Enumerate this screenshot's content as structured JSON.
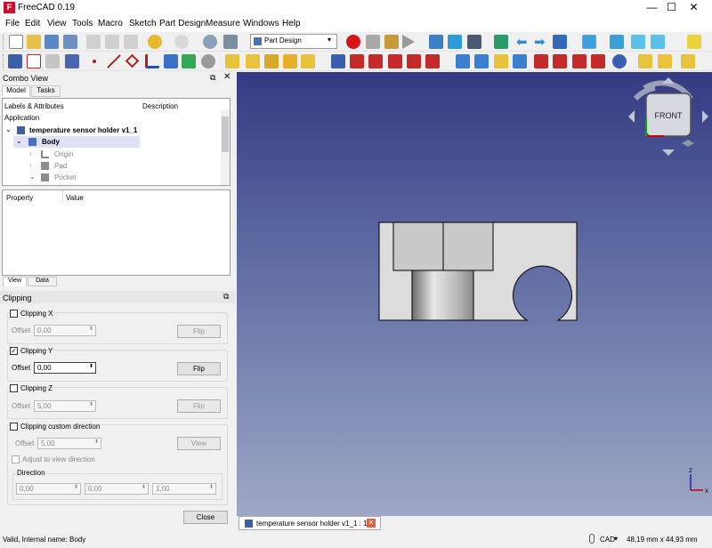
{
  "window": {
    "title": "FreeCAD 0.19",
    "icon": "freecad-icon",
    "icon_letter": "F",
    "minimize": "—",
    "maximize": "☐",
    "close": "✕"
  },
  "menu": [
    "File",
    "Edit",
    "View",
    "Tools",
    "Macro",
    "Sketch",
    "Part Design",
    "Measure",
    "Windows",
    "Help"
  ],
  "toolbar": {
    "workbench": "Part Design"
  },
  "combo": {
    "title": "Combo View",
    "tabs": [
      "Model",
      "Tasks"
    ],
    "tree_header": {
      "labels": "Labels & Attributes",
      "description": "Description"
    },
    "tree": {
      "section": "Application",
      "document": "temperature sensor holder v1_1",
      "body": "Body",
      "children": [
        "Origin",
        "Pad",
        "Pocket"
      ]
    },
    "property_header": {
      "property": "Property",
      "value": "Value"
    },
    "view_tabs": [
      "View",
      "Data"
    ]
  },
  "clipping": {
    "title": "Clipping",
    "x": {
      "label": "Clipping X",
      "checked": false,
      "offset_label": "Offset",
      "offset": "0,00",
      "flip": "Flip"
    },
    "y": {
      "label": "Clipping Y",
      "checked": true,
      "offset_label": "Offset",
      "offset": "0,00",
      "flip": "Flip"
    },
    "z": {
      "label": "Clipping Z",
      "checked": false,
      "offset_label": "Offset",
      "offset": "5,00",
      "flip": "Flip"
    },
    "custom": {
      "label": "Clipping custom direction",
      "checked": false,
      "offset_label": "Offset",
      "offset": "5,00",
      "view": "View",
      "adjust": "Adjust to view direction",
      "direction_label": "Direction",
      "direction": [
        "0,00",
        "0,00",
        "1,00"
      ]
    },
    "close": "Close"
  },
  "navcube": {
    "face": "FRONT"
  },
  "axes": {
    "x": "x",
    "z": "z"
  },
  "document_tab": "temperature sensor holder v1_1 : 1*",
  "status": {
    "left": "Valid, Internal name: Body",
    "nav_style": "CAD",
    "dimensions": "48,19 mm x 44,93 mm"
  },
  "colors": {
    "view_top": "#343a82",
    "view_bottom": "#9ea7c6",
    "part_face": "#dcdcdc",
    "selection": "#e0e0f6"
  }
}
